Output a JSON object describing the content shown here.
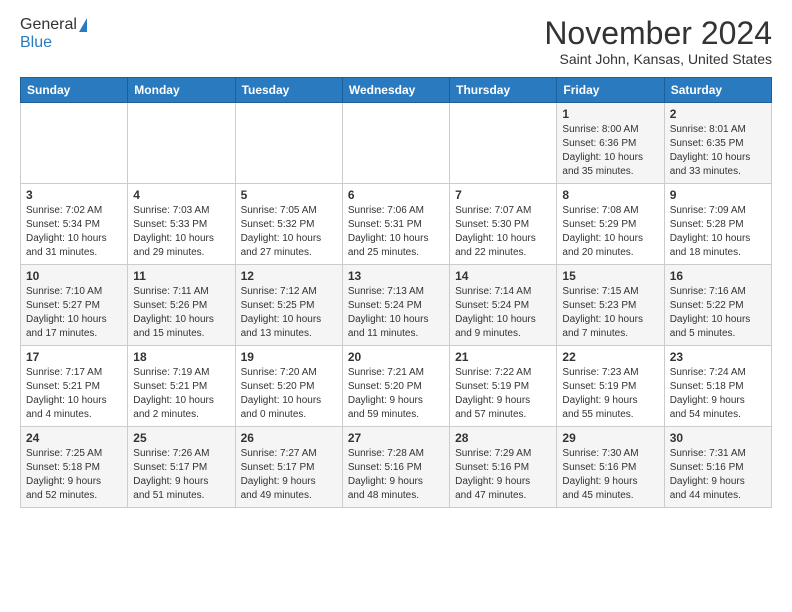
{
  "logo": {
    "line1": "General",
    "line2": "Blue"
  },
  "title": "November 2024",
  "subtitle": "Saint John, Kansas, United States",
  "days_of_week": [
    "Sunday",
    "Monday",
    "Tuesday",
    "Wednesday",
    "Thursday",
    "Friday",
    "Saturday"
  ],
  "weeks": [
    [
      {
        "day": "",
        "info": ""
      },
      {
        "day": "",
        "info": ""
      },
      {
        "day": "",
        "info": ""
      },
      {
        "day": "",
        "info": ""
      },
      {
        "day": "",
        "info": ""
      },
      {
        "day": "1",
        "info": "Sunrise: 8:00 AM\nSunset: 6:36 PM\nDaylight: 10 hours\nand 35 minutes."
      },
      {
        "day": "2",
        "info": "Sunrise: 8:01 AM\nSunset: 6:35 PM\nDaylight: 10 hours\nand 33 minutes."
      }
    ],
    [
      {
        "day": "3",
        "info": "Sunrise: 7:02 AM\nSunset: 5:34 PM\nDaylight: 10 hours\nand 31 minutes."
      },
      {
        "day": "4",
        "info": "Sunrise: 7:03 AM\nSunset: 5:33 PM\nDaylight: 10 hours\nand 29 minutes."
      },
      {
        "day": "5",
        "info": "Sunrise: 7:05 AM\nSunset: 5:32 PM\nDaylight: 10 hours\nand 27 minutes."
      },
      {
        "day": "6",
        "info": "Sunrise: 7:06 AM\nSunset: 5:31 PM\nDaylight: 10 hours\nand 25 minutes."
      },
      {
        "day": "7",
        "info": "Sunrise: 7:07 AM\nSunset: 5:30 PM\nDaylight: 10 hours\nand 22 minutes."
      },
      {
        "day": "8",
        "info": "Sunrise: 7:08 AM\nSunset: 5:29 PM\nDaylight: 10 hours\nand 20 minutes."
      },
      {
        "day": "9",
        "info": "Sunrise: 7:09 AM\nSunset: 5:28 PM\nDaylight: 10 hours\nand 18 minutes."
      }
    ],
    [
      {
        "day": "10",
        "info": "Sunrise: 7:10 AM\nSunset: 5:27 PM\nDaylight: 10 hours\nand 17 minutes."
      },
      {
        "day": "11",
        "info": "Sunrise: 7:11 AM\nSunset: 5:26 PM\nDaylight: 10 hours\nand 15 minutes."
      },
      {
        "day": "12",
        "info": "Sunrise: 7:12 AM\nSunset: 5:25 PM\nDaylight: 10 hours\nand 13 minutes."
      },
      {
        "day": "13",
        "info": "Sunrise: 7:13 AM\nSunset: 5:24 PM\nDaylight: 10 hours\nand 11 minutes."
      },
      {
        "day": "14",
        "info": "Sunrise: 7:14 AM\nSunset: 5:24 PM\nDaylight: 10 hours\nand 9 minutes."
      },
      {
        "day": "15",
        "info": "Sunrise: 7:15 AM\nSunset: 5:23 PM\nDaylight: 10 hours\nand 7 minutes."
      },
      {
        "day": "16",
        "info": "Sunrise: 7:16 AM\nSunset: 5:22 PM\nDaylight: 10 hours\nand 5 minutes."
      }
    ],
    [
      {
        "day": "17",
        "info": "Sunrise: 7:17 AM\nSunset: 5:21 PM\nDaylight: 10 hours\nand 4 minutes."
      },
      {
        "day": "18",
        "info": "Sunrise: 7:19 AM\nSunset: 5:21 PM\nDaylight: 10 hours\nand 2 minutes."
      },
      {
        "day": "19",
        "info": "Sunrise: 7:20 AM\nSunset: 5:20 PM\nDaylight: 10 hours\nand 0 minutes."
      },
      {
        "day": "20",
        "info": "Sunrise: 7:21 AM\nSunset: 5:20 PM\nDaylight: 9 hours\nand 59 minutes."
      },
      {
        "day": "21",
        "info": "Sunrise: 7:22 AM\nSunset: 5:19 PM\nDaylight: 9 hours\nand 57 minutes."
      },
      {
        "day": "22",
        "info": "Sunrise: 7:23 AM\nSunset: 5:19 PM\nDaylight: 9 hours\nand 55 minutes."
      },
      {
        "day": "23",
        "info": "Sunrise: 7:24 AM\nSunset: 5:18 PM\nDaylight: 9 hours\nand 54 minutes."
      }
    ],
    [
      {
        "day": "24",
        "info": "Sunrise: 7:25 AM\nSunset: 5:18 PM\nDaylight: 9 hours\nand 52 minutes."
      },
      {
        "day": "25",
        "info": "Sunrise: 7:26 AM\nSunset: 5:17 PM\nDaylight: 9 hours\nand 51 minutes."
      },
      {
        "day": "26",
        "info": "Sunrise: 7:27 AM\nSunset: 5:17 PM\nDaylight: 9 hours\nand 49 minutes."
      },
      {
        "day": "27",
        "info": "Sunrise: 7:28 AM\nSunset: 5:16 PM\nDaylight: 9 hours\nand 48 minutes."
      },
      {
        "day": "28",
        "info": "Sunrise: 7:29 AM\nSunset: 5:16 PM\nDaylight: 9 hours\nand 47 minutes."
      },
      {
        "day": "29",
        "info": "Sunrise: 7:30 AM\nSunset: 5:16 PM\nDaylight: 9 hours\nand 45 minutes."
      },
      {
        "day": "30",
        "info": "Sunrise: 7:31 AM\nSunset: 5:16 PM\nDaylight: 9 hours\nand 44 minutes."
      }
    ]
  ]
}
